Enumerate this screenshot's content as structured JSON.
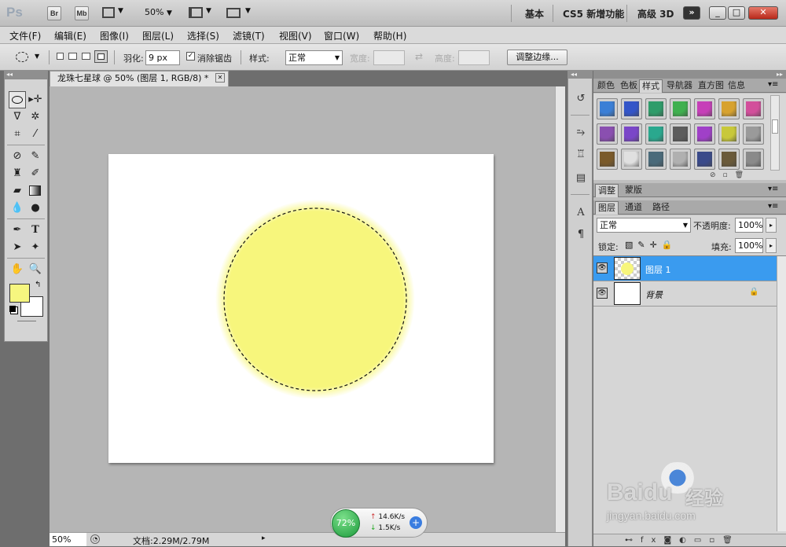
{
  "app": {
    "logo": "Ps",
    "launch_bridge": "Br",
    "launch_minibridge": "Mb",
    "zoom": "50%"
  },
  "workspaces": [
    "基本",
    "CS5 新增功能",
    "高级 3D"
  ],
  "window_controls": {
    "more": "»",
    "minimize": "_",
    "restore": "□",
    "close": "✕"
  },
  "menu": [
    "文件(F)",
    "编辑(E)",
    "图像(I)",
    "图层(L)",
    "选择(S)",
    "滤镜(T)",
    "视图(V)",
    "窗口(W)",
    "帮助(H)"
  ],
  "options": {
    "feather_label": "羽化:",
    "feather_value": "9 px",
    "antialias_label": "消除锯齿",
    "style_label": "样式:",
    "style_value": "正常",
    "width_label": "宽度:",
    "height_label": "高度:",
    "refine_edge": "调整边缘..."
  },
  "document": {
    "tab_title": "龙珠七星球 @ 50% (图层 1, RGB/8) *",
    "close": "✕"
  },
  "status": {
    "zoom": "50%",
    "doc_info": "文档:2.29M/2.79M"
  },
  "net_widget": {
    "percent": "72%",
    "up": "14.6K/s",
    "down": "1.5K/s"
  },
  "panels": {
    "top_tabs": [
      "颜色",
      "色板",
      "样式",
      "导航器",
      "直方图",
      "信息"
    ],
    "top_active": "样式",
    "mid_tabs": [
      "调整",
      "蒙版"
    ],
    "layer_tabs": [
      "图层",
      "通道",
      "路径"
    ],
    "blend_mode": "正常",
    "opacity_label": "不透明度:",
    "opacity_value": "100%",
    "lock_label": "锁定:",
    "fill_label": "填充:",
    "fill_value": "100%",
    "layers": [
      {
        "name": "图层 1"
      },
      {
        "name": "背景"
      }
    ]
  },
  "colors": {
    "circle": "#f7f67c",
    "selection_blue": "#3a9bef",
    "foreground": "#f6f67f",
    "background": "#ffffff"
  },
  "style_swatch_colors": [
    "#3b7fd6",
    "#3355c8",
    "#2f9c6a",
    "#3fb04f",
    "#c63fb8",
    "#d7a22f",
    "#d24f9b",
    "#8a4fb0",
    "#7a46c8",
    "#2aa88e",
    "#5c5c5c",
    "#a040c8",
    "#c8c83a",
    "#9a9a9a",
    "#7a5a2a",
    "#e0e0e0",
    "#4a6a7a",
    "#b0b0b0",
    "#3a4a8a",
    "#6a5a3a",
    "#8a8a8a"
  ],
  "watermark": {
    "logo": "Baidu",
    "cn": "经验",
    "url": "jingyan.baidu.com"
  }
}
